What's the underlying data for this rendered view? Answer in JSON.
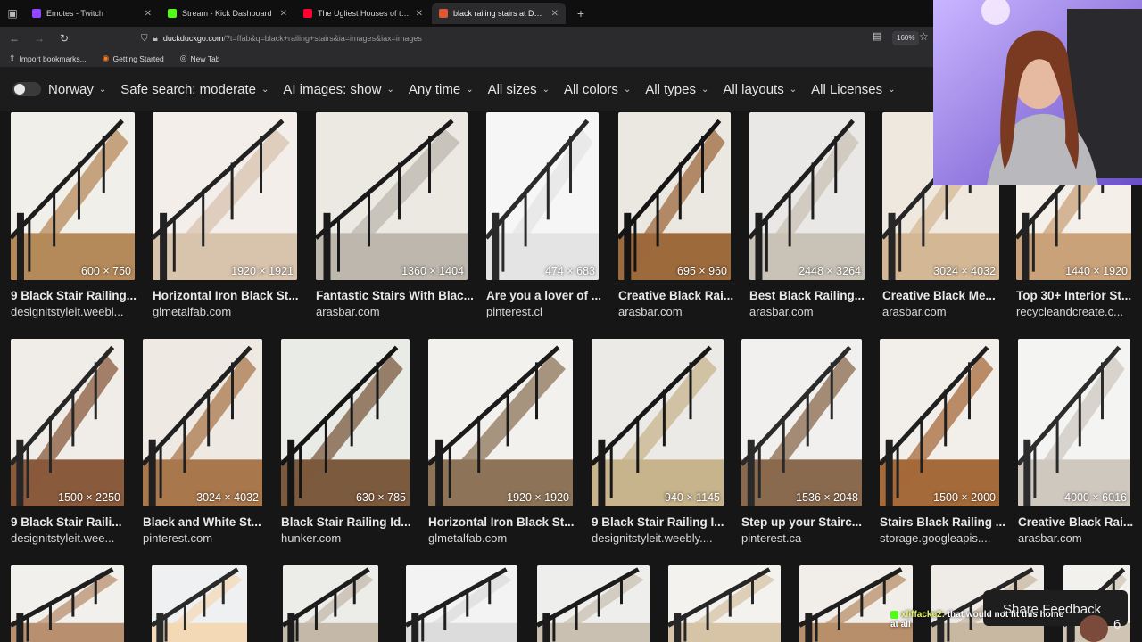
{
  "browser": {
    "tabs": [
      {
        "label": "Emotes - Twitch",
        "color": "#9146ff"
      },
      {
        "label": "Stream - Kick Dashboard",
        "color": "#53fc18"
      },
      {
        "label": "The Ugliest Houses of the North",
        "color": "#ff0033"
      },
      {
        "label": "black railing stairs at DuckDuck",
        "color": "#de5833"
      }
    ],
    "url_domain": "duckduckgo.com",
    "url_path": "/?t=ffab&q=black+railing+stairs&ia=images&iax=images",
    "zoom": "160%",
    "bookmarks": [
      {
        "label": "Import bookmarks...",
        "icon": "import-icon"
      },
      {
        "label": "Getting Started",
        "icon": "firefox-icon"
      },
      {
        "label": "New Tab",
        "icon": "globe-icon"
      }
    ]
  },
  "filters": {
    "region": "Norway",
    "safe_search": "Safe search: moderate",
    "ai_images": "AI images: show",
    "time": "Any time",
    "sizes": "All sizes",
    "colors": "All colors",
    "types": "All types",
    "layouts": "All layouts",
    "licenses": "All Licenses"
  },
  "results": [
    {
      "title": "9 Black Stair Railing...",
      "source": "designitstyleit.weebl...",
      "dims": "600 × 750",
      "tone": [
        "#f1efe9",
        "#1d1d1d",
        "#b58a5a"
      ]
    },
    {
      "title": "Horizontal Iron Black St...",
      "source": "glmetalfab.com",
      "dims": "1920 × 1921",
      "tone": [
        "#f3eeea",
        "#222222",
        "#d8c3ad"
      ]
    },
    {
      "title": "Fantastic Stairs With Blac...",
      "source": "arasbar.com",
      "dims": "1360 × 1404",
      "tone": [
        "#ece9e3",
        "#1a1a1a",
        "#bdb7ad"
      ]
    },
    {
      "title": "Are you a lover of ...",
      "source": "pinterest.cl",
      "dims": "474 × 683",
      "tone": [
        "#f6f6f6",
        "#2a2a2a",
        "#e4e4e4"
      ]
    },
    {
      "title": "Creative Black Rai...",
      "source": "arasbar.com",
      "dims": "695 × 960",
      "tone": [
        "#ebe8e2",
        "#141414",
        "#9d6a3c"
      ]
    },
    {
      "title": "Best Black Railing...",
      "source": "arasbar.com",
      "dims": "2448 × 3264",
      "tone": [
        "#e9e8e6",
        "#1e1e1e",
        "#c9c2b6"
      ]
    },
    {
      "title": "Creative Black Me...",
      "source": "arasbar.com",
      "dims": "3024 × 4032",
      "tone": [
        "#efe8de",
        "#262626",
        "#d4b896"
      ]
    },
    {
      "title": "Top 30+ Interior St...",
      "source": "recycleandcreate.c...",
      "dims": "1440 × 1920",
      "tone": [
        "#f4efe8",
        "#232323",
        "#c9a27a"
      ]
    },
    {
      "title": "9 Black Stair Raili...",
      "source": "designitstyleit.wee...",
      "dims": "1500 × 2250",
      "tone": [
        "#f0ede8",
        "#262626",
        "#8a5a3c"
      ]
    },
    {
      "title": "Black and White St...",
      "source": "pinterest.com",
      "dims": "3024 × 4032",
      "tone": [
        "#eee9e2",
        "#202020",
        "#a9774c"
      ]
    },
    {
      "title": "Black Stair Railing Id...",
      "source": "hunker.com",
      "dims": "630 × 785",
      "tone": [
        "#e8ebe6",
        "#151515",
        "#7c5a3e"
      ]
    },
    {
      "title": "Horizontal Iron Black St...",
      "source": "glmetalfab.com",
      "dims": "1920 × 1920",
      "tone": [
        "#f3f1ee",
        "#1b1b1b",
        "#8d7458"
      ]
    },
    {
      "title": "9 Black Stair Railing I...",
      "source": "designitstyleit.weebly....",
      "dims": "940 × 1145",
      "tone": [
        "#eceae6",
        "#181818",
        "#c8b48c"
      ]
    },
    {
      "title": "Step up your Stairc...",
      "source": "pinterest.ca",
      "dims": "1536 × 2048",
      "tone": [
        "#f1f0ee",
        "#2a2a2a",
        "#8a6a4e"
      ]
    },
    {
      "title": "Stairs Black Railing ...",
      "source": "storage.googleapis....",
      "dims": "1500 × 2000",
      "tone": [
        "#f2efea",
        "#1f1f1f",
        "#a56a3a"
      ]
    },
    {
      "title": "Creative Black Rai...",
      "source": "arasbar.com",
      "dims": "4000 × 6016",
      "tone": [
        "#f4f4f3",
        "#2c2c2c",
        "#cfc8bf"
      ]
    },
    {
      "title": "",
      "source": "",
      "dims": "",
      "tone": [
        "#f2f0ec",
        "#1e1e1e",
        "#b89070"
      ]
    },
    {
      "title": "",
      "source": "",
      "dims": "",
      "tone": [
        "#eef0f1",
        "#2a2a2a",
        "#f3d9b5"
      ]
    },
    {
      "title": "",
      "source": "",
      "dims": "",
      "tone": [
        "#ecece9",
        "#1c1c1c",
        "#c4b9a9"
      ]
    },
    {
      "title": "",
      "source": "",
      "dims": "",
      "tone": [
        "#f3f3f3",
        "#202020",
        "#dcdcdc"
      ]
    },
    {
      "title": "",
      "source": "",
      "dims": "",
      "tone": [
        "#eeeeec",
        "#1b1b1b",
        "#c9c0b2"
      ]
    },
    {
      "title": "",
      "source": "",
      "dims": "",
      "tone": [
        "#f4f2ef",
        "#262626",
        "#d7c3a6"
      ]
    },
    {
      "title": "",
      "source": "",
      "dims": "",
      "tone": [
        "#f1eeea",
        "#1e1e1e",
        "#b78f6a"
      ]
    },
    {
      "title": "",
      "source": "",
      "dims": "",
      "tone": [
        "#efece8",
        "#262626",
        "#c8b8a2"
      ]
    },
    {
      "title": "",
      "source": "",
      "dims": "",
      "tone": [
        "#f3f1ee",
        "#222222",
        "#d0c4b5"
      ]
    }
  ],
  "overlay": {
    "feedback_label": "Share Feedback",
    "feedback_count": "6",
    "chat_user": "xliffacke2:",
    "chat_message": "that would not fit this home at all"
  }
}
